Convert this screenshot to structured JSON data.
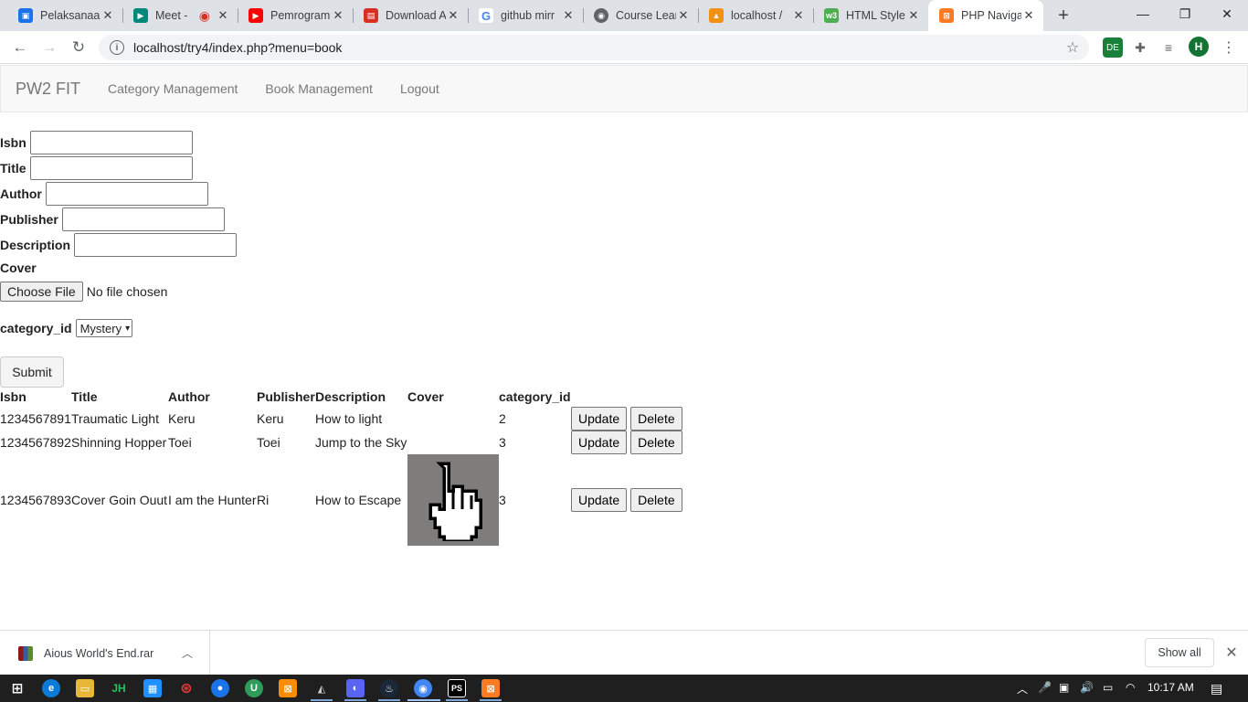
{
  "browser": {
    "tabs": [
      {
        "title": "Pelaksanaan",
        "color": "#1a73e8",
        "glyph": "▣"
      },
      {
        "title": "Meet - ",
        "color": "#00897b",
        "glyph": "▶"
      },
      {
        "title": "Pemrogram",
        "color": "#ff0000",
        "glyph": "▶"
      },
      {
        "title": "Download A",
        "color": "#d93025",
        "glyph": "▤"
      },
      {
        "title": "github mirr",
        "color": "#4285f4",
        "glyph": "G"
      },
      {
        "title": "Course Lear",
        "color": "#5f6368",
        "glyph": "◉"
      },
      {
        "title": "localhost / ",
        "color": "#f29111",
        "glyph": "▲"
      },
      {
        "title": "HTML Style",
        "color": "#4caf50",
        "glyph": "w3"
      },
      {
        "title": "PHP Naviga",
        "color": "#fb7a24",
        "glyph": "⊠"
      }
    ],
    "address": "localhost/try4/index.php?menu=book",
    "profile_initial": "H"
  },
  "navbar": {
    "brand": "PW2 FIT",
    "links": [
      "Category Management",
      "Book Management",
      "Logout"
    ]
  },
  "form": {
    "isbn_label": "Isbn",
    "title_label": "Title",
    "author_label": "Author",
    "publisher_label": "Publisher",
    "description_label": "Description",
    "cover_label": "Cover",
    "file_button": "Choose File",
    "file_status": "No file chosen",
    "category_label": "category_id",
    "category_selected": "Mystery",
    "submit_label": "Submit"
  },
  "table": {
    "headers": [
      "Isbn",
      "Title",
      "Author",
      "Publisher",
      "Description",
      "Cover",
      "category_id"
    ],
    "rows": [
      {
        "isbn": "1234567891",
        "title": "Traumatic Light",
        "author": "Keru",
        "publisher": "Keru",
        "description": "How to light",
        "cover": "",
        "category_id": "2"
      },
      {
        "isbn": "1234567892",
        "title": "Shinning Hopper",
        "author": "Toei",
        "publisher": "Toei",
        "description": "Jump to the Sky",
        "cover": "",
        "category_id": "3"
      },
      {
        "isbn": "1234567893",
        "title": "Cover Goin Ouut",
        "author": "I am the Hunter",
        "publisher": "Ri",
        "description": "How to Escape",
        "cover": "hand-cursor-image",
        "category_id": "3"
      }
    ],
    "update_label": "Update",
    "delete_label": "Delete"
  },
  "downloads": {
    "file_name": "Aious World's End.rar",
    "show_all": "Show all"
  },
  "taskbar": {
    "time": "10:17 AM"
  }
}
